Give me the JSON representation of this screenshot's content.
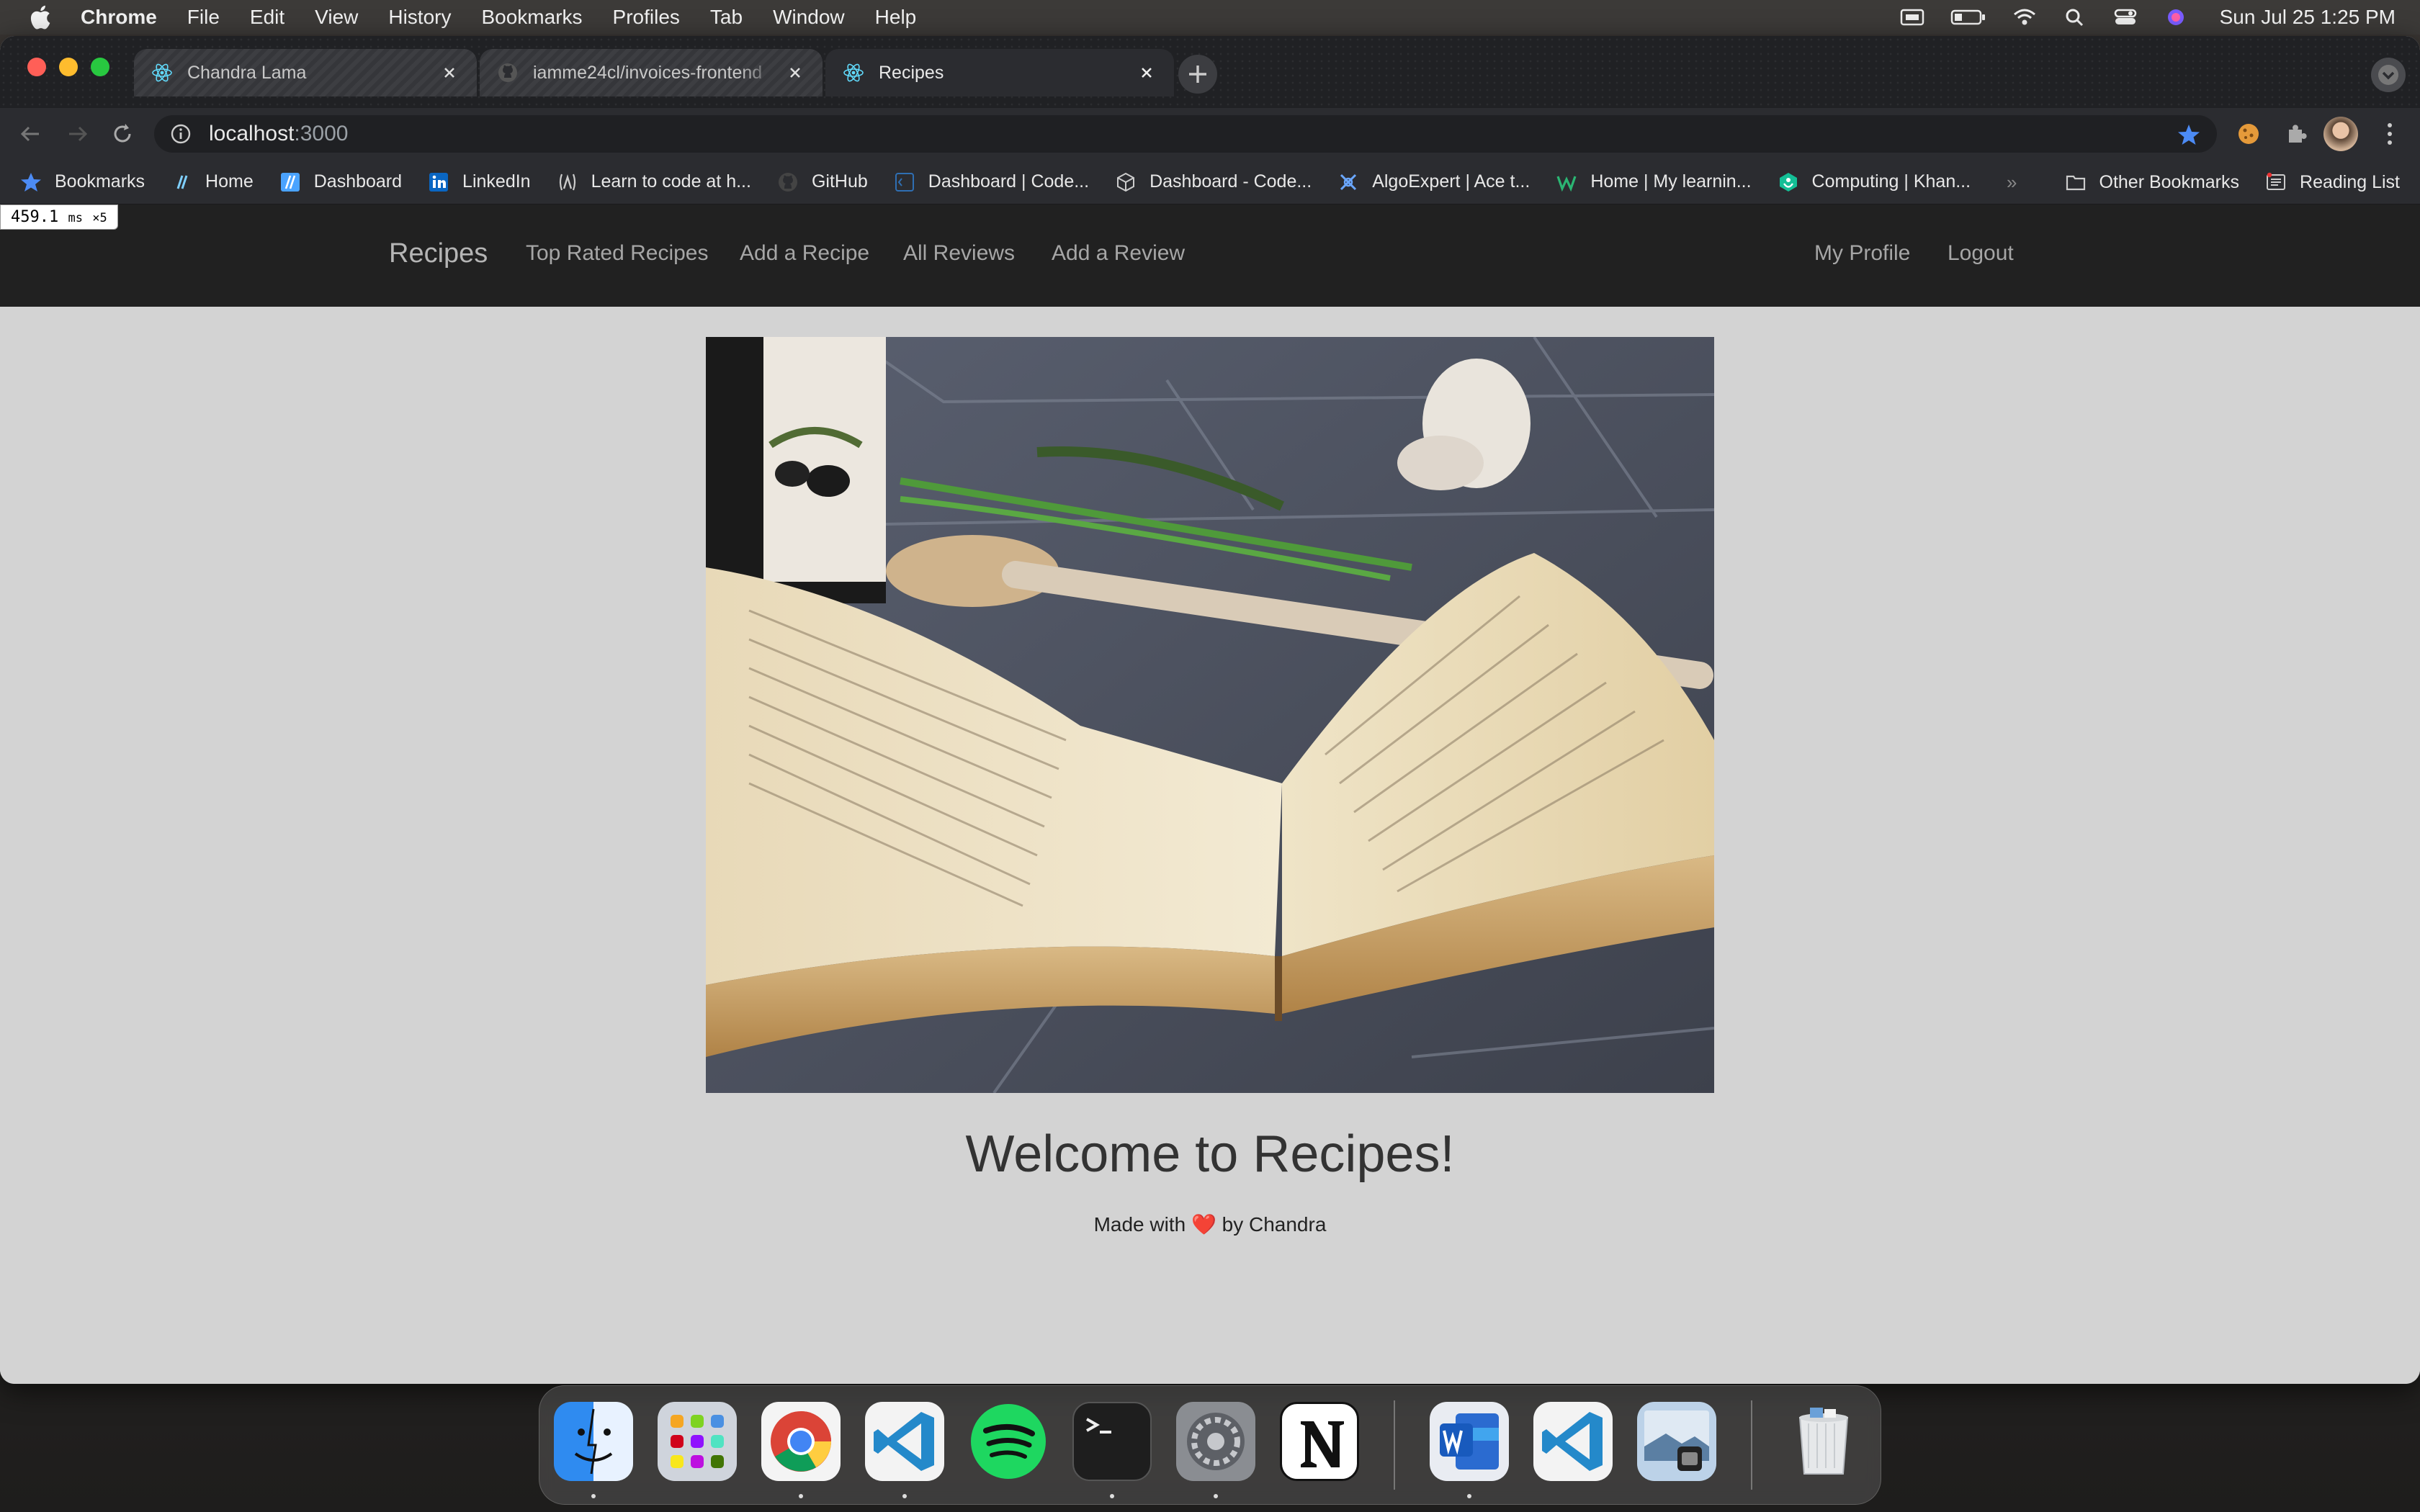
{
  "menubar": {
    "app": "Chrome",
    "items": [
      "File",
      "Edit",
      "View",
      "History",
      "Bookmarks",
      "Profiles",
      "Tab",
      "Window",
      "Help"
    ],
    "clock": "Sun Jul 25  1:25 PM"
  },
  "tabs": [
    {
      "label": "Chandra Lama",
      "icon": "react-icon"
    },
    {
      "label": "iamme24cl/invoices-frontend",
      "icon": "github-icon"
    },
    {
      "label": "Recipes",
      "icon": "react-icon"
    }
  ],
  "address": {
    "host": "localhost",
    "port": ":3000"
  },
  "bookmarks": [
    {
      "label": "Bookmarks",
      "icon": "star-icon"
    },
    {
      "label": "Home",
      "icon": "slash-icon"
    },
    {
      "label": "Dashboard",
      "icon": "slash-square-icon"
    },
    {
      "label": "LinkedIn",
      "icon": "linkedin-icon"
    },
    {
      "label": "Learn to code at h...",
      "icon": "lambda-icon"
    },
    {
      "label": "GitHub",
      "icon": "github-icon"
    },
    {
      "label": "Dashboard | Code...",
      "icon": "code-icon"
    },
    {
      "label": "Dashboard - Code...",
      "icon": "cube-icon"
    },
    {
      "label": "AlgoExpert | Ace t...",
      "icon": "algoexpert-icon"
    },
    {
      "label": "Home | My learnin...",
      "icon": "w-icon"
    },
    {
      "label": "Computing | Khan...",
      "icon": "khan-icon"
    }
  ],
  "bookmarks_overflow": "»",
  "other_bookmarks": "Other Bookmarks",
  "reading_list": "Reading List",
  "perf": {
    "value": "459.1",
    "unit": "ms",
    "mult": "×5"
  },
  "app": {
    "brand": "Recipes",
    "nav": [
      "Top Rated Recipes",
      "Add a Recipe",
      "All Reviews",
      "Add a Review"
    ],
    "nav_right": [
      "My Profile",
      "Logout"
    ],
    "welcome": "Welcome to Recipes!",
    "made_with": "Made with",
    "heart": "❤️",
    "by": "by Chandra"
  },
  "dock": [
    "finder-icon",
    "launchpad-icon",
    "chrome-icon",
    "vscode-icon",
    "spotify-icon",
    "terminal-icon",
    "system-preferences-icon",
    "notion-icon",
    "word-icon",
    "vscode-icon",
    "preview-icon",
    "trash-icon"
  ]
}
